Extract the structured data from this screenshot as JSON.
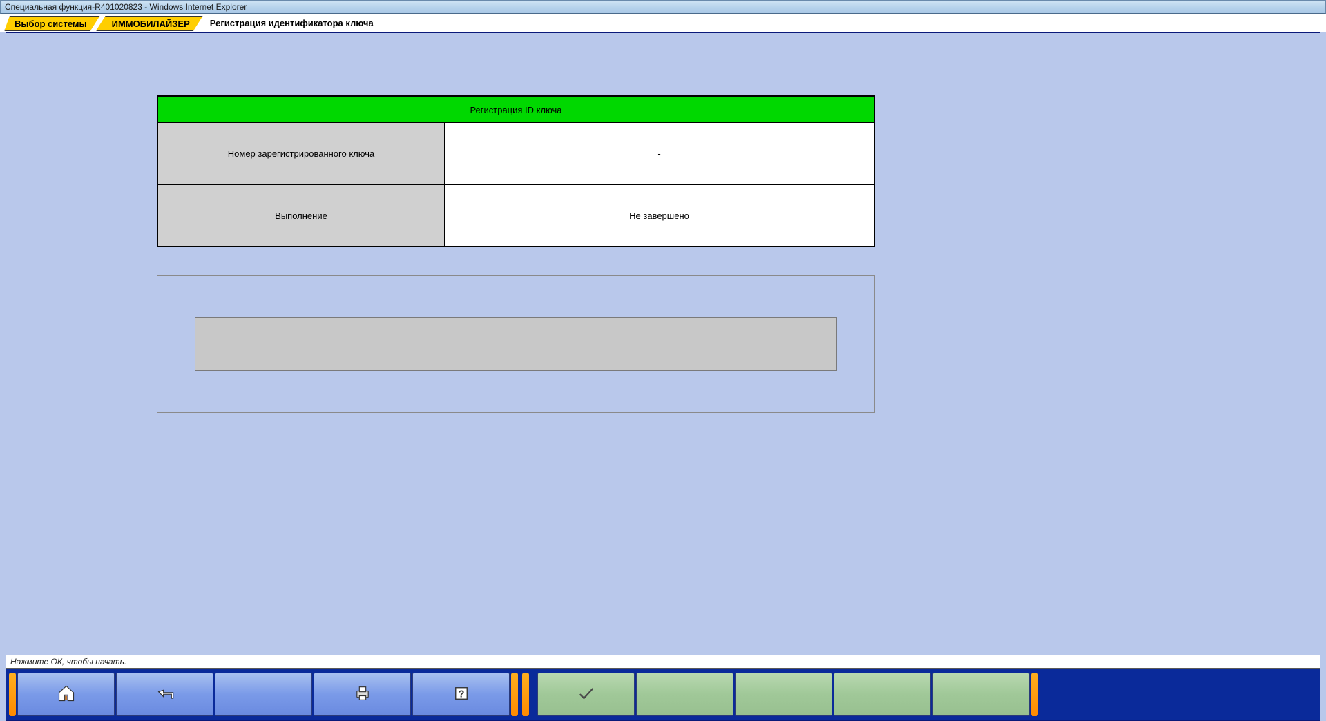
{
  "window": {
    "title": "Специальная функция-R401020823 - Windows Internet Explorer"
  },
  "breadcrumb": {
    "items": [
      {
        "label": "Выбор системы"
      },
      {
        "label": "ИММОБИЛАЙЗЕР"
      }
    ],
    "current": "Регистрация идентификатора ключа"
  },
  "table": {
    "header": "Регистрация ID ключа",
    "rows": [
      {
        "label": "Номер зарегистрированного ключа",
        "value": "-"
      },
      {
        "label": "Выполнение",
        "value": "Не завершено"
      }
    ]
  },
  "info_panel": {
    "message": ""
  },
  "status": {
    "text": "Нажмите ОК, чтобы начать."
  },
  "toolbar": {
    "left": [
      {
        "name": "home-button",
        "icon": "home"
      },
      {
        "name": "back-button",
        "icon": "back"
      },
      {
        "name": "blank-button-1",
        "icon": ""
      },
      {
        "name": "print-button",
        "icon": "print"
      },
      {
        "name": "help-button",
        "icon": "help"
      }
    ],
    "right": [
      {
        "name": "ok-button",
        "icon": "check"
      },
      {
        "name": "blank-g1",
        "icon": ""
      },
      {
        "name": "blank-g2",
        "icon": ""
      },
      {
        "name": "blank-g3",
        "icon": ""
      },
      {
        "name": "blank-g4",
        "icon": ""
      }
    ]
  }
}
